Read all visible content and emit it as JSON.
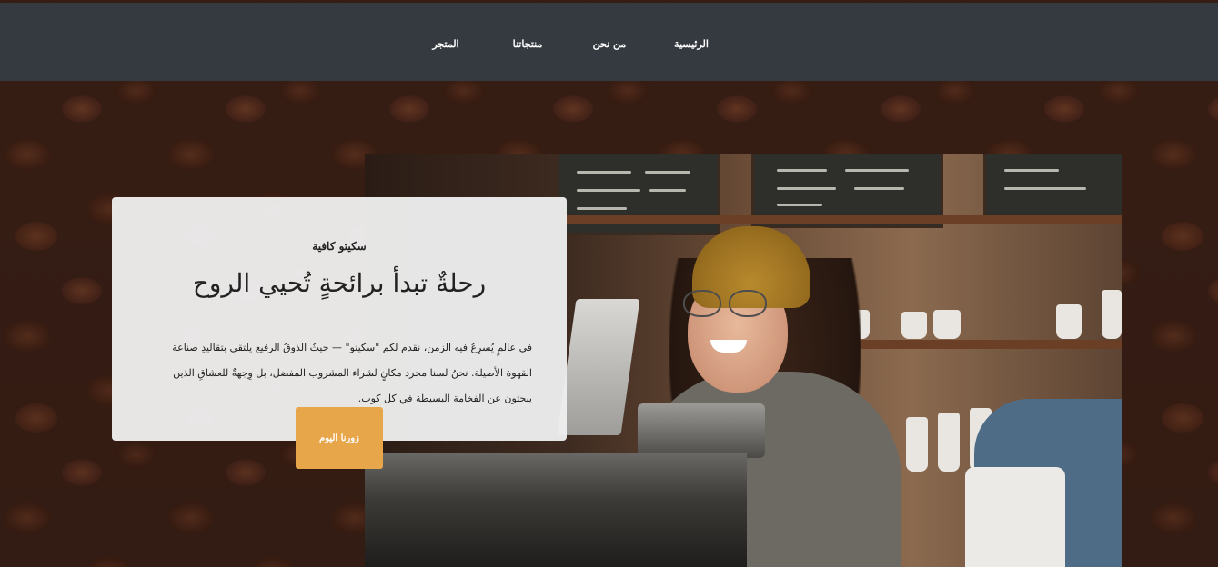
{
  "nav": {
    "items": [
      {
        "label": "الرئيسية"
      },
      {
        "label": "من نحن"
      },
      {
        "label": "منتجاتنا"
      },
      {
        "label": "المتجر"
      }
    ]
  },
  "hero": {
    "brand": "سكيتو كافية",
    "headline": "رحلةٌ تبدأ برائحةٍ تُحيي الروح",
    "description": "في عالمٍ يُسرِعُ فيه الزمن، نقدم لكم \"سكيتو\" — حيثُ الذوقُ الرفيع يلتقي بتقاليدِ صناعة القهوة الأصيلة. نحنُ لسنا مجرد مكانٍ لشراء المشروب المفضل، بل وِجهةٌ للعشاقِ الذين يبحثون عن الفخامة البسيطة في كل كوب.",
    "cta_label": "زورنا اليوم"
  },
  "colors": {
    "navbar": "#343a40",
    "card": "#eeeeee",
    "cta": "#e8a64b",
    "beans": "#3a2016"
  },
  "icons": {
    "photo": "barista-photo"
  }
}
